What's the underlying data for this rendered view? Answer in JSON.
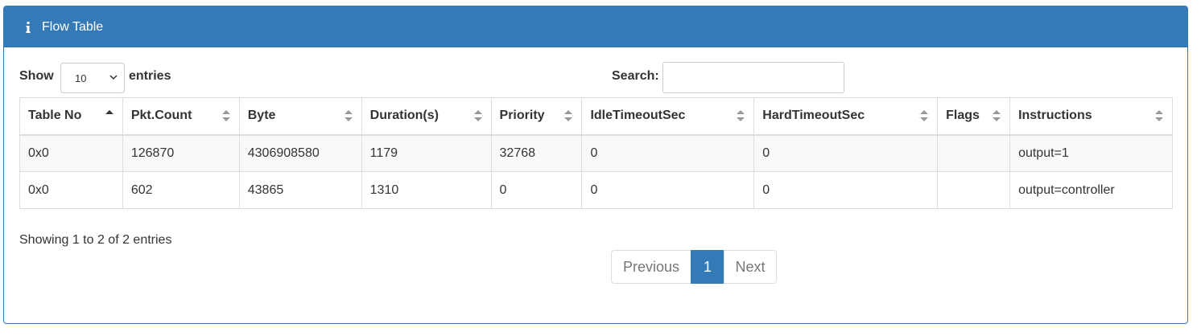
{
  "panel": {
    "title": "Flow Table",
    "icon": "info-icon",
    "accent_color": "#337ab7"
  },
  "controls": {
    "show_label": "Show",
    "page_length_value": "10",
    "entries_label": "entries",
    "search_label": "Search:",
    "search_value": ""
  },
  "table": {
    "columns": [
      {
        "label": "Table No",
        "sort": "asc"
      },
      {
        "label": "Pkt.Count",
        "sort": "both"
      },
      {
        "label": "Byte",
        "sort": "both"
      },
      {
        "label": "Duration(s)",
        "sort": "both"
      },
      {
        "label": "Priority",
        "sort": "both"
      },
      {
        "label": "IdleTimeoutSec",
        "sort": "both"
      },
      {
        "label": "HardTimeoutSec",
        "sort": "both"
      },
      {
        "label": "Flags",
        "sort": "both"
      },
      {
        "label": "Instructions",
        "sort": "both"
      }
    ],
    "rows": [
      [
        "0x0",
        "126870",
        "4306908580",
        "1179",
        "32768",
        "0",
        "0",
        "",
        "output=1"
      ],
      [
        "0x0",
        "602",
        "43865",
        "1310",
        "0",
        "0",
        "0",
        "",
        "output=controller"
      ]
    ]
  },
  "footer": {
    "info": "Showing 1 to 2 of 2 entries",
    "previous_label": "Previous",
    "current_page": "1",
    "next_label": "Next"
  }
}
